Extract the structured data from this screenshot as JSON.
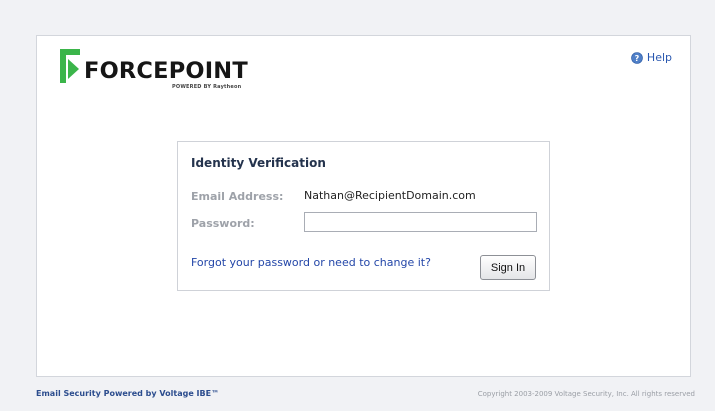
{
  "brand": {
    "name": "FORCEPOINT",
    "tagline": "POWERED BY Raytheon",
    "colors": {
      "mark": "#3bb54a",
      "text": "#161616"
    }
  },
  "header": {
    "help_label": "Help",
    "help_icon": "help-icon"
  },
  "form": {
    "title": "Identity Verification",
    "email_label": "Email Address:",
    "email_value": "Nathan@RecipientDomain.com",
    "password_label": "Password:",
    "password_value": "",
    "forgot_link": "Forgot your password or need to change it?",
    "signin_label": "Sign In"
  },
  "footer": {
    "left_text": "Email Security Powered by Voltage IBE™",
    "right_text": "Copyright 2003-2009 Voltage Security, Inc. All rights reserved"
  },
  "colors": {
    "page_background": "#f1f2f5",
    "link": "#2346a8",
    "label": "#9ea2a9"
  }
}
